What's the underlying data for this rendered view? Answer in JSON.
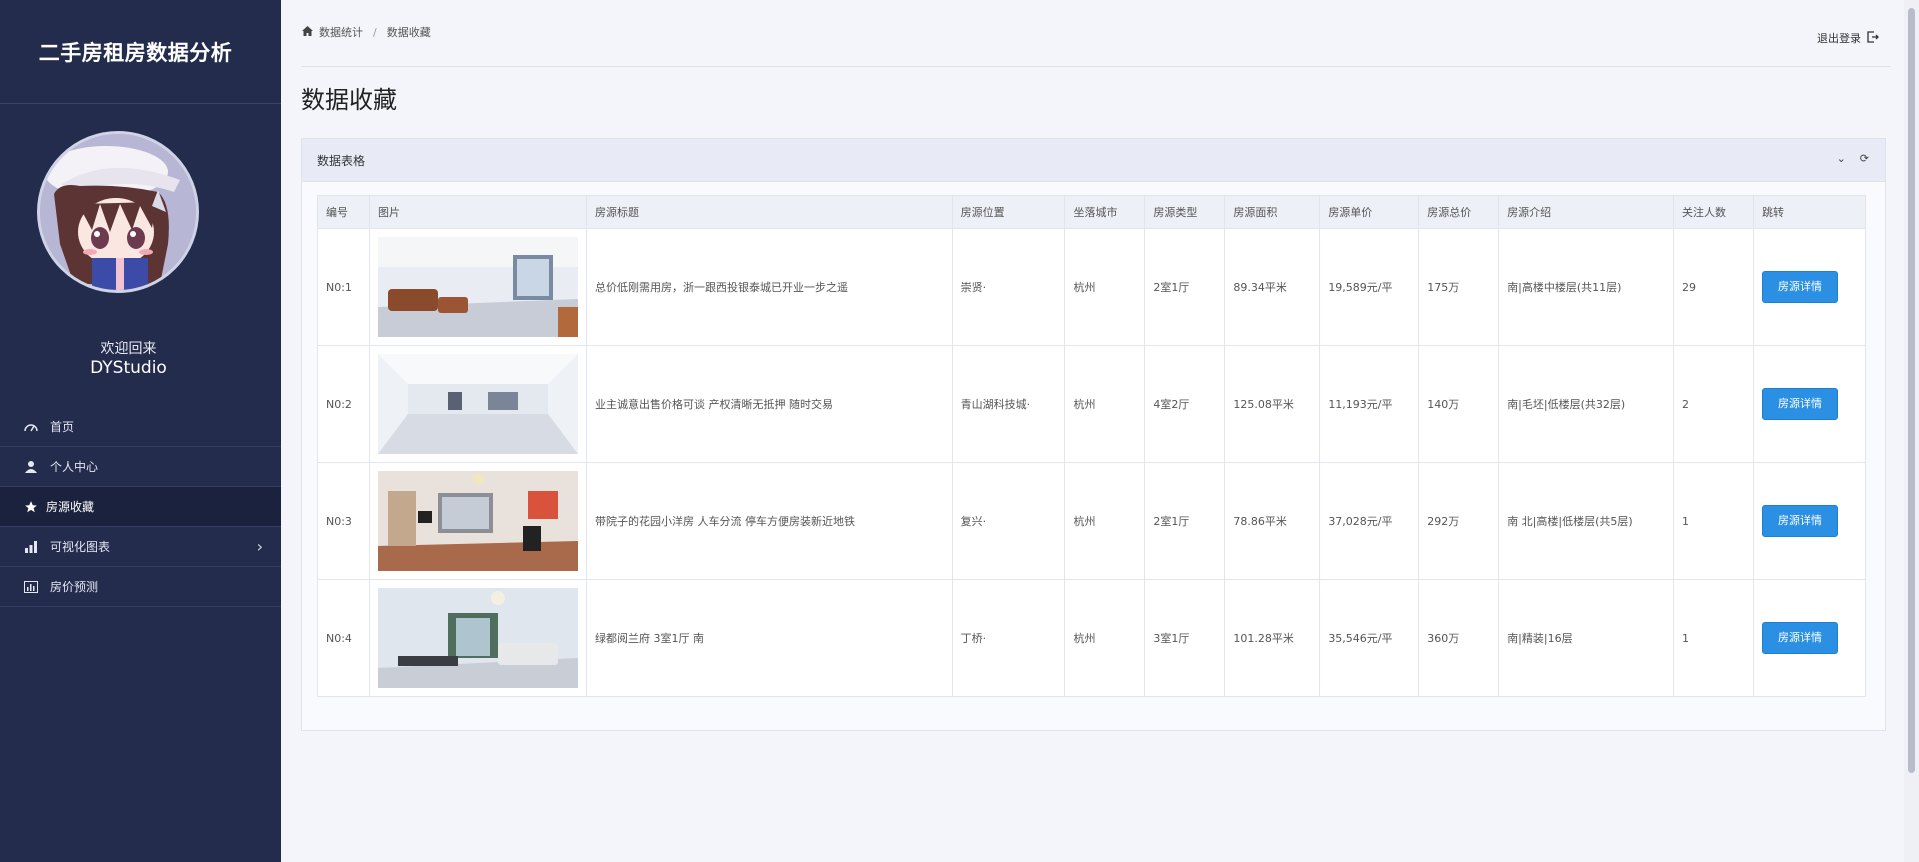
{
  "app": {
    "title": "二手房租房数据分析",
    "welcome": "欢迎回来",
    "username": "DYStudio"
  },
  "sidebar": {
    "items": [
      {
        "label": "首页",
        "icon": "dashboard-icon",
        "active": false
      },
      {
        "label": "个人中心",
        "icon": "user-icon",
        "active": false
      },
      {
        "label": "房源收藏",
        "icon": "star-icon",
        "active": true
      },
      {
        "label": "可视化图表",
        "icon": "bar-chart-icon",
        "active": false,
        "has_submenu": true
      },
      {
        "label": "房价预测",
        "icon": "chart-box-icon",
        "active": false
      }
    ]
  },
  "header": {
    "breadcrumb": [
      "数据统计",
      "数据收藏"
    ],
    "breadcrumb_sep": "/",
    "logout_label": "退出登录"
  },
  "page": {
    "title": "数据收藏"
  },
  "card": {
    "title": "数据表格"
  },
  "table": {
    "columns": [
      "编号",
      "图片",
      "房源标题",
      "房源位置",
      "坐落城市",
      "房源类型",
      "房源面积",
      "房源单价",
      "房源总价",
      "房源介绍",
      "关注人数",
      "跳转"
    ],
    "rows": [
      {
        "id": "N0:1",
        "title": "总价低刚需用房，浙一跟西投银泰城已开业一步之遥",
        "location": "崇贤·",
        "city": "杭州",
        "type": "2室1厅",
        "area": "89.34平米",
        "unit_price": "19,589元/平",
        "total_price": "175万",
        "intro": "南|高楼中楼层(共11层)",
        "followers": "29",
        "action": "房源详情"
      },
      {
        "id": "N0:2",
        "title": "业主诚意出售价格可谈 产权清晰无抵押 随时交易",
        "location": "青山湖科技城·",
        "city": "杭州",
        "type": "4室2厅",
        "area": "125.08平米",
        "unit_price": "11,193元/平",
        "total_price": "140万",
        "intro": "南|毛坯|低楼层(共32层)",
        "followers": "2",
        "action": "房源详情"
      },
      {
        "id": "N0:3",
        "title": "带院子的花园小洋房 人车分流 停车方便房装新近地铁",
        "location": "复兴·",
        "city": "杭州",
        "type": "2室1厅",
        "area": "78.86平米",
        "unit_price": "37,028元/平",
        "total_price": "292万",
        "intro": "南 北|高楼|低楼层(共5层)",
        "followers": "1",
        "action": "房源详情"
      },
      {
        "id": "N0:4",
        "title": "绿都阅兰府 3室1厅 南",
        "location": "丁桥·",
        "city": "杭州",
        "type": "3室1厅",
        "area": "101.28平米",
        "unit_price": "35,546元/平",
        "total_price": "360万",
        "intro": "南|精装|16层",
        "followers": "1",
        "action": "房源详情"
      }
    ]
  },
  "colors": {
    "sidebar_bg": "#232c4c",
    "accent_button": "#2b90e3",
    "page_bg": "#f4f5fa"
  }
}
